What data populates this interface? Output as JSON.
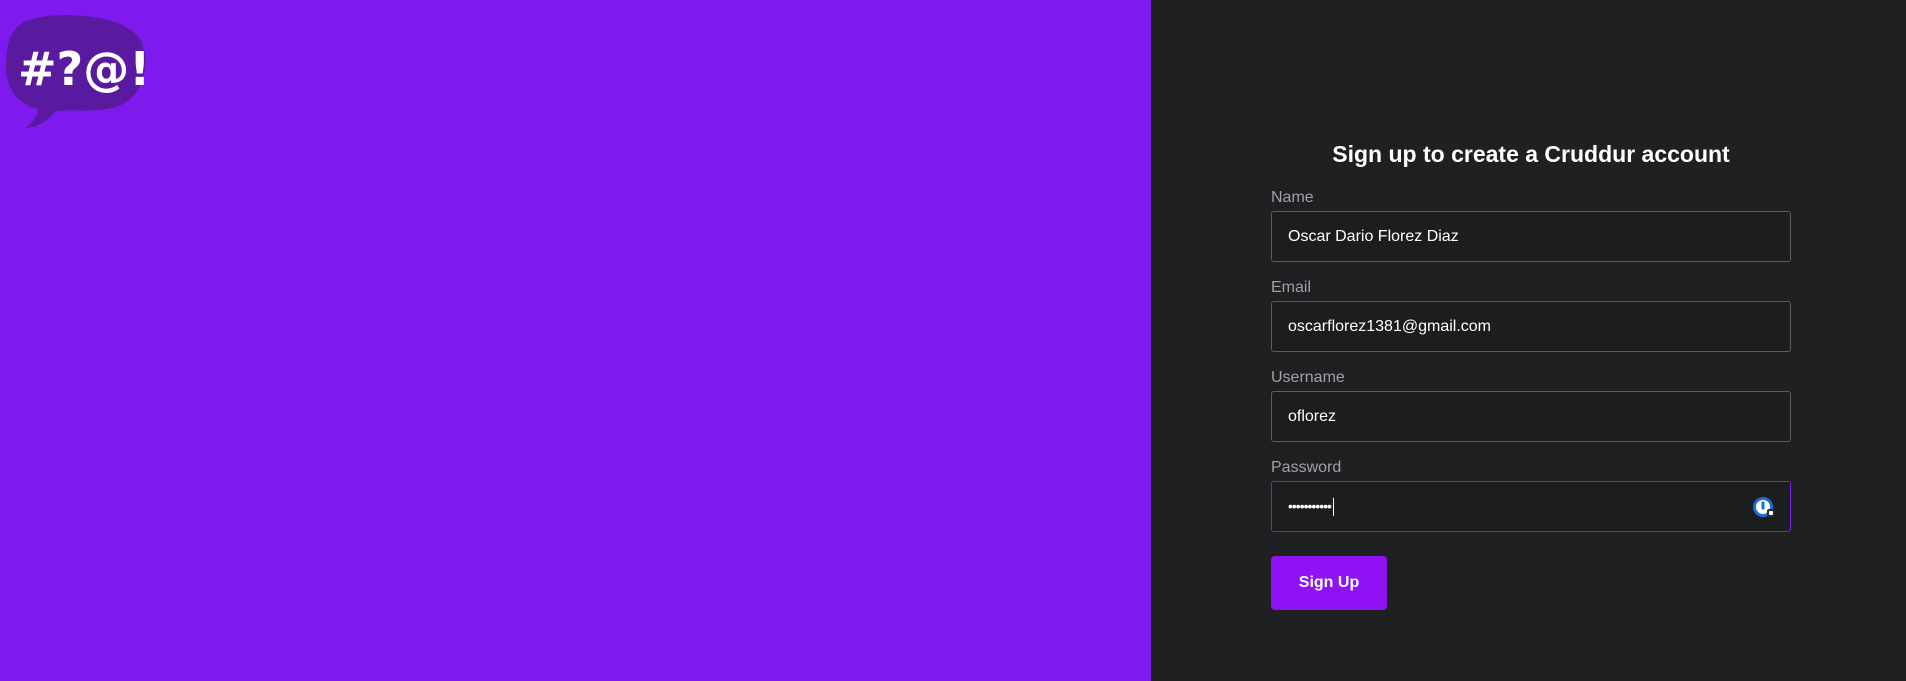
{
  "brand": {
    "logo_text": "#?@!",
    "accent_color": "#7e1aee"
  },
  "signup": {
    "title": "Sign up to create a Cruddur account",
    "fields": {
      "name": {
        "label": "Name",
        "value": "Oscar Dario Florez Diaz"
      },
      "email": {
        "label": "Email",
        "value": "oscarflorez1381@gmail.com"
      },
      "username": {
        "label": "Username",
        "value": "oflorez"
      },
      "password": {
        "label": "Password",
        "masked_value": "•••••••••••"
      }
    },
    "submit_label": "Sign Up"
  },
  "icons": {
    "password_manager": "password-manager-icon"
  }
}
